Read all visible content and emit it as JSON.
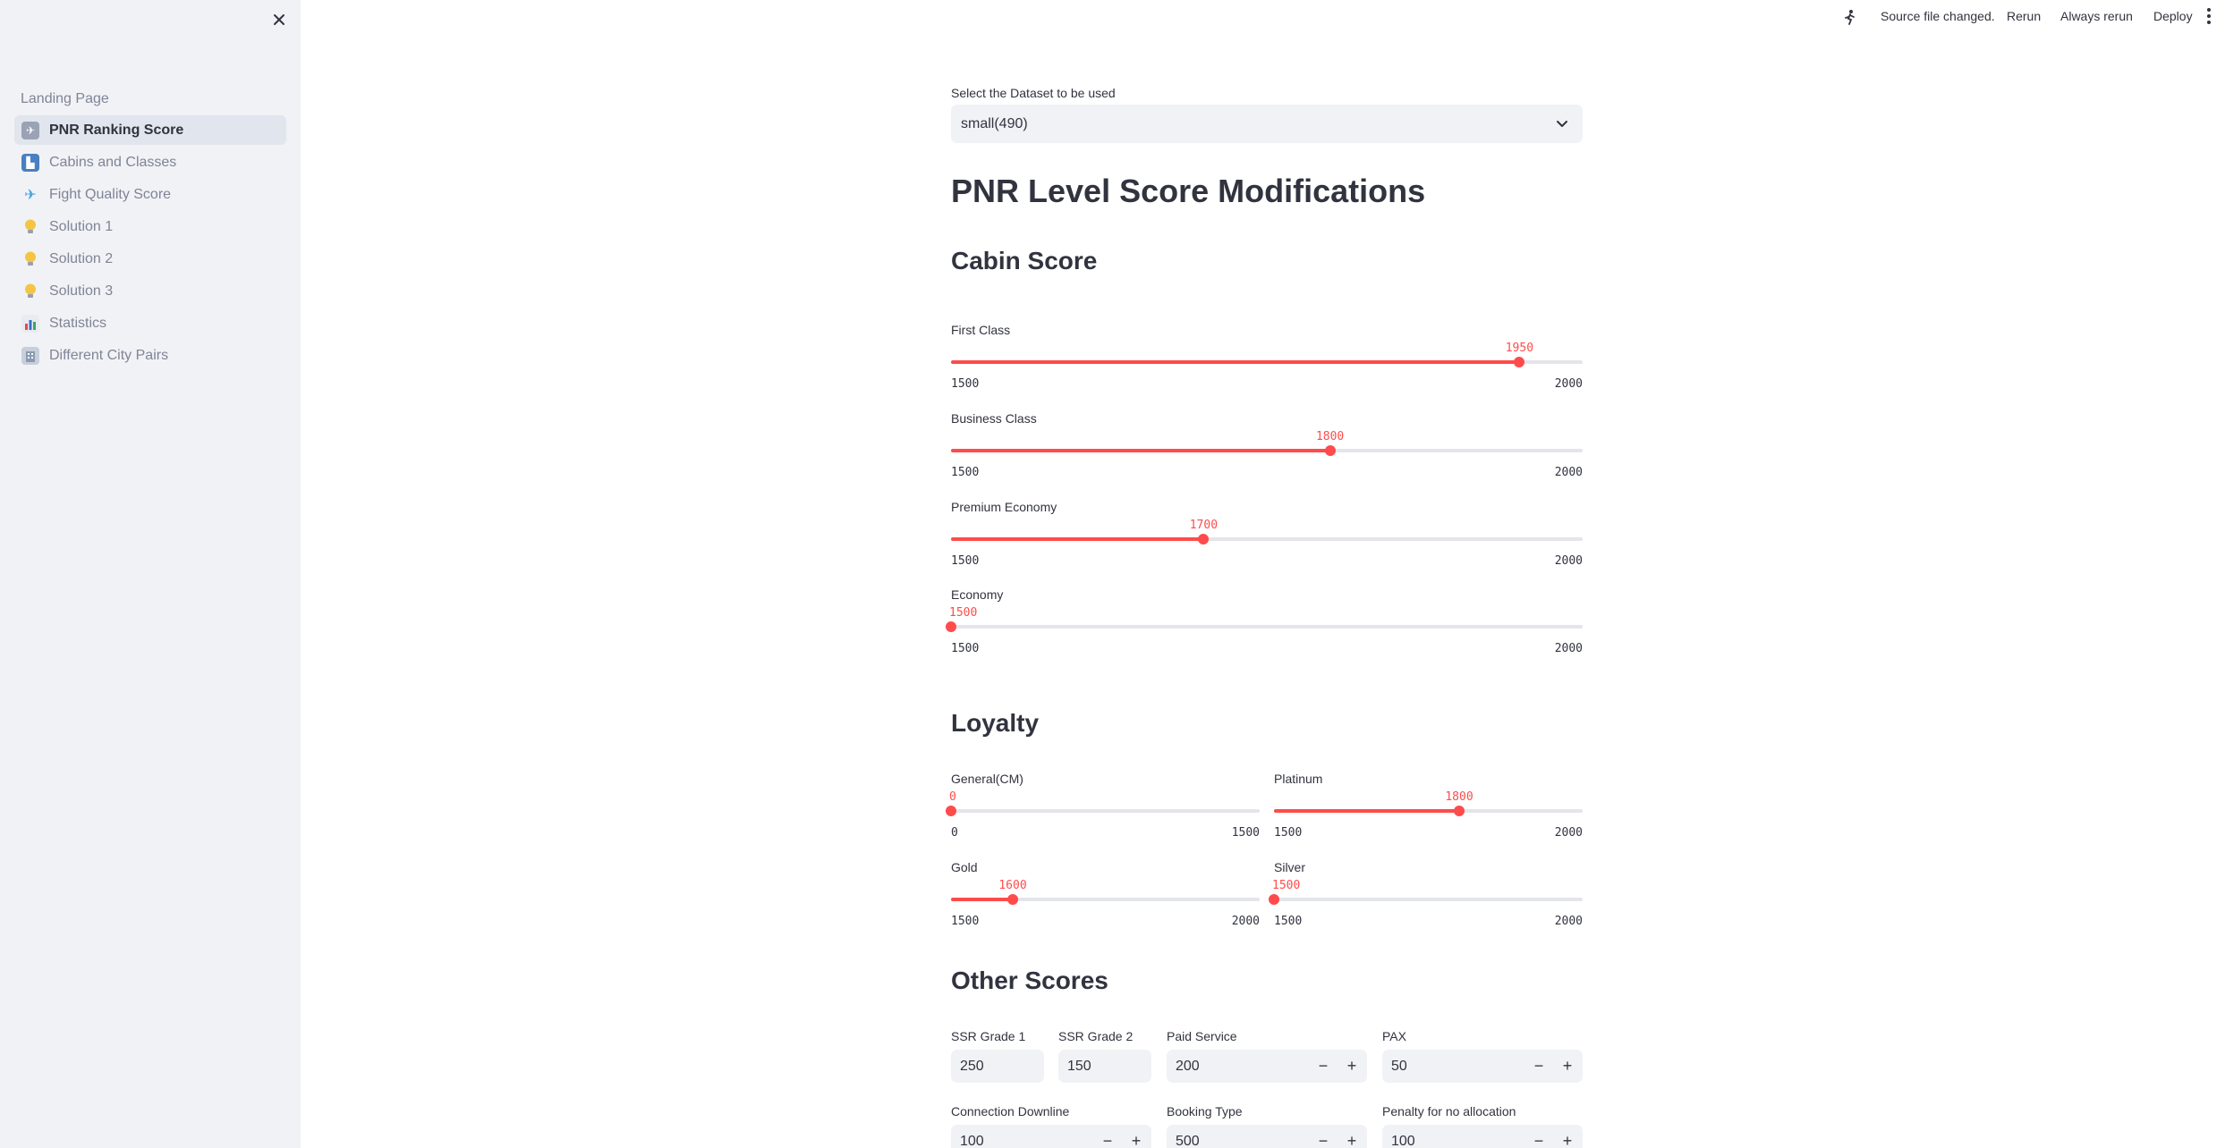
{
  "sidebar": {
    "close_icon": "close-icon",
    "section_title": "Landing Page",
    "items": [
      {
        "label": "PNR Ranking Score",
        "icon": "ticket-icon",
        "color": "#9aa3b5",
        "active": true
      },
      {
        "label": "Cabins and Classes",
        "icon": "seat-icon",
        "color": "#4a7fc1",
        "active": false
      },
      {
        "label": "Fight Quality Score",
        "icon": "airplane-icon",
        "color": "#4aa3df",
        "active": false
      },
      {
        "label": "Solution 1",
        "icon": "lightbulb-icon",
        "color": "#f4c542",
        "active": false
      },
      {
        "label": "Solution 2",
        "icon": "lightbulb-icon",
        "color": "#f4c542",
        "active": false
      },
      {
        "label": "Solution 3",
        "icon": "lightbulb-icon",
        "color": "#f4c542",
        "active": false
      },
      {
        "label": "Statistics",
        "icon": "bar-chart-icon",
        "color": "#5b6b8c",
        "active": false
      },
      {
        "label": "Different City Pairs",
        "icon": "building-icon",
        "color": "#8a9bb0",
        "active": false
      }
    ]
  },
  "topbar": {
    "source_changed": "Source file changed.",
    "rerun": "Rerun",
    "always_rerun": "Always rerun",
    "deploy": "Deploy"
  },
  "main": {
    "dataset_label": "Select the Dataset to be used",
    "dataset_value": "small(490)",
    "page_title": "PNR Level Score Modifications",
    "cabin_heading": "Cabin Score",
    "loyalty_heading": "Loyalty",
    "other_heading": "Other Scores",
    "cabin_sliders": [
      {
        "label": "First Class",
        "value": 1950,
        "min": 1500,
        "max": 2000,
        "value_text": "1950",
        "min_text": "1500",
        "max_text": "2000"
      },
      {
        "label": "Business Class",
        "value": 1800,
        "min": 1500,
        "max": 2000,
        "value_text": "1800",
        "min_text": "1500",
        "max_text": "2000"
      },
      {
        "label": "Premium Economy",
        "value": 1700,
        "min": 1500,
        "max": 2000,
        "value_text": "1700",
        "min_text": "1500",
        "max_text": "2000"
      },
      {
        "label": "Economy",
        "value": 1500,
        "min": 1500,
        "max": 2000,
        "value_text": "1500",
        "min_text": "1500",
        "max_text": "2000"
      }
    ],
    "loyalty_sliders": [
      {
        "label": "General(CM)",
        "value": 0,
        "min": 0,
        "max": 1500,
        "value_text": "0",
        "min_text": "0",
        "max_text": "1500"
      },
      {
        "label": "Platinum",
        "value": 1800,
        "min": 1500,
        "max": 2000,
        "value_text": "1800",
        "min_text": "1500",
        "max_text": "2000"
      },
      {
        "label": "Gold",
        "value": 1600,
        "min": 1500,
        "max": 2000,
        "value_text": "1600",
        "min_text": "1500",
        "max_text": "2000"
      },
      {
        "label": "Silver",
        "value": 1500,
        "min": 1500,
        "max": 2000,
        "value_text": "1500",
        "min_text": "1500",
        "max_text": "2000"
      }
    ],
    "other_inputs": [
      {
        "label": "SSR Grade 1",
        "value": "250",
        "stepper": false
      },
      {
        "label": "SSR Grade 2",
        "value": "150",
        "stepper": false
      },
      {
        "label": "Paid Service",
        "value": "200",
        "stepper": true
      },
      {
        "label": "PAX",
        "value": "50",
        "stepper": true
      },
      {
        "label": "Connection Downline",
        "value": "100",
        "stepper": true
      },
      {
        "label": "Booking Type",
        "value": "500",
        "stepper": true
      },
      {
        "label": "Penalty for no allocation",
        "value": "100",
        "stepper": true
      }
    ],
    "minus_symbol": "−",
    "plus_symbol": "+"
  }
}
